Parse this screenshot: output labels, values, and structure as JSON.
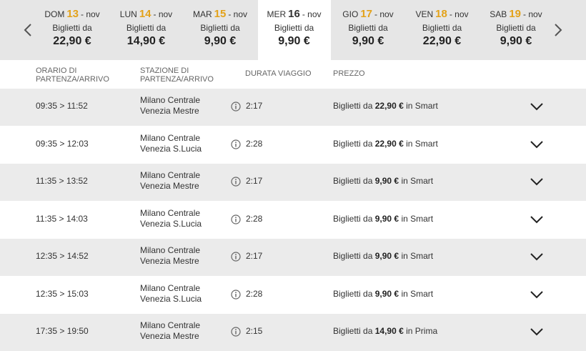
{
  "dates": {
    "items": [
      {
        "dow": "DOM",
        "num": "13",
        "month": "- nov",
        "label": "Biglietti da",
        "price": "22,90 €",
        "selected": false
      },
      {
        "dow": "LUN",
        "num": "14",
        "month": "- nov",
        "label": "Biglietti da",
        "price": "14,90 €",
        "selected": false
      },
      {
        "dow": "MAR",
        "num": "15",
        "month": "- nov",
        "label": "Biglietti da",
        "price": "9,90 €",
        "selected": false
      },
      {
        "dow": "MER",
        "num": "16",
        "month": "- nov",
        "label": "Biglietti da",
        "price": "9,90 €",
        "selected": true
      },
      {
        "dow": "GIO",
        "num": "17",
        "month": "- nov",
        "label": "Biglietti da",
        "price": "9,90 €",
        "selected": false
      },
      {
        "dow": "VEN",
        "num": "18",
        "month": "- nov",
        "label": "Biglietti da",
        "price": "22,90 €",
        "selected": false
      },
      {
        "dow": "SAB",
        "num": "19",
        "month": "- nov",
        "label": "Biglietti da",
        "price": "9,90 €",
        "selected": false
      }
    ],
    "prev_icon": "chevron-left-icon",
    "next_icon": "chevron-right-icon"
  },
  "columns": {
    "time_line1": "ORARIO DI",
    "time_line2": "PARTENZA/ARRIVO",
    "station_line1": "STAZIONE DI",
    "station_line2": "PARTENZA/ARRIVO",
    "duration": "DURATA VIAGGIO",
    "price": "PREZZO"
  },
  "rows": [
    {
      "time": "09:35 > 11:52",
      "from": "Milano Centrale",
      "to": "Venezia Mestre",
      "duration": "2:17",
      "price_prefix": "Biglietti da",
      "price": "22,90 €",
      "price_suffix": "in Smart"
    },
    {
      "time": "09:35 > 12:03",
      "from": "Milano Centrale",
      "to": "Venezia S.Lucia",
      "duration": "2:28",
      "price_prefix": "Biglietti da",
      "price": "22,90 €",
      "price_suffix": "in Smart"
    },
    {
      "time": "11:35 > 13:52",
      "from": "Milano Centrale",
      "to": "Venezia Mestre",
      "duration": "2:17",
      "price_prefix": "Biglietti da",
      "price": "9,90 €",
      "price_suffix": "in Smart"
    },
    {
      "time": "11:35 > 14:03",
      "from": "Milano Centrale",
      "to": "Venezia S.Lucia",
      "duration": "2:28",
      "price_prefix": "Biglietti da",
      "price": "9,90 €",
      "price_suffix": "in Smart"
    },
    {
      "time": "12:35 > 14:52",
      "from": "Milano Centrale",
      "to": "Venezia Mestre",
      "duration": "2:17",
      "price_prefix": "Biglietti da",
      "price": "9,90 €",
      "price_suffix": "in Smart"
    },
    {
      "time": "12:35 > 15:03",
      "from": "Milano Centrale",
      "to": "Venezia S.Lucia",
      "duration": "2:28",
      "price_prefix": "Biglietti da",
      "price": "9,90 €",
      "price_suffix": "in Smart"
    },
    {
      "time": "17:35 > 19:50",
      "from": "Milano Centrale",
      "to": "Venezia Mestre",
      "duration": "2:15",
      "price_prefix": "Biglietti da",
      "price": "14,90 €",
      "price_suffix": "in Prima"
    }
  ],
  "colors": {
    "accent": "#e3a21a",
    "selected_bg": "#ffffff",
    "bar_bg": "#e6e6e6",
    "row_alt": "#ebebeb"
  },
  "icons": {
    "info": "info-icon",
    "expand": "chevron-down-icon"
  }
}
